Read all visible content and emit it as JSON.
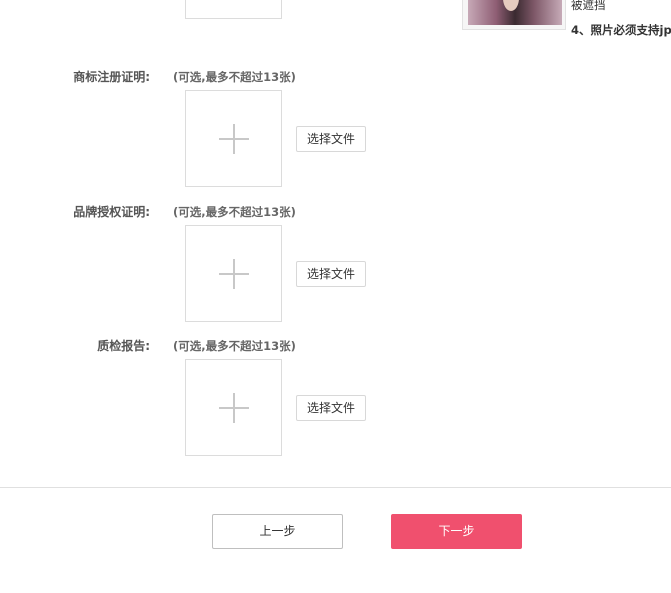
{
  "top_tips": {
    "line1": "被遮挡",
    "line2": "4、照片必须支持jp"
  },
  "sections": [
    {
      "label": "商标注册证明:",
      "hint": "(可选,最多不超过13张)",
      "button": "选择文件"
    },
    {
      "label": "品牌授权证明:",
      "hint": "(可选,最多不超过13张)",
      "button": "选择文件"
    },
    {
      "label": "质检报告:",
      "hint": "(可选,最多不超过13张)",
      "button": "选择文件"
    }
  ],
  "footer": {
    "prev_label": "上一步",
    "next_label": "下一步",
    "next_color": "#f0506e"
  }
}
